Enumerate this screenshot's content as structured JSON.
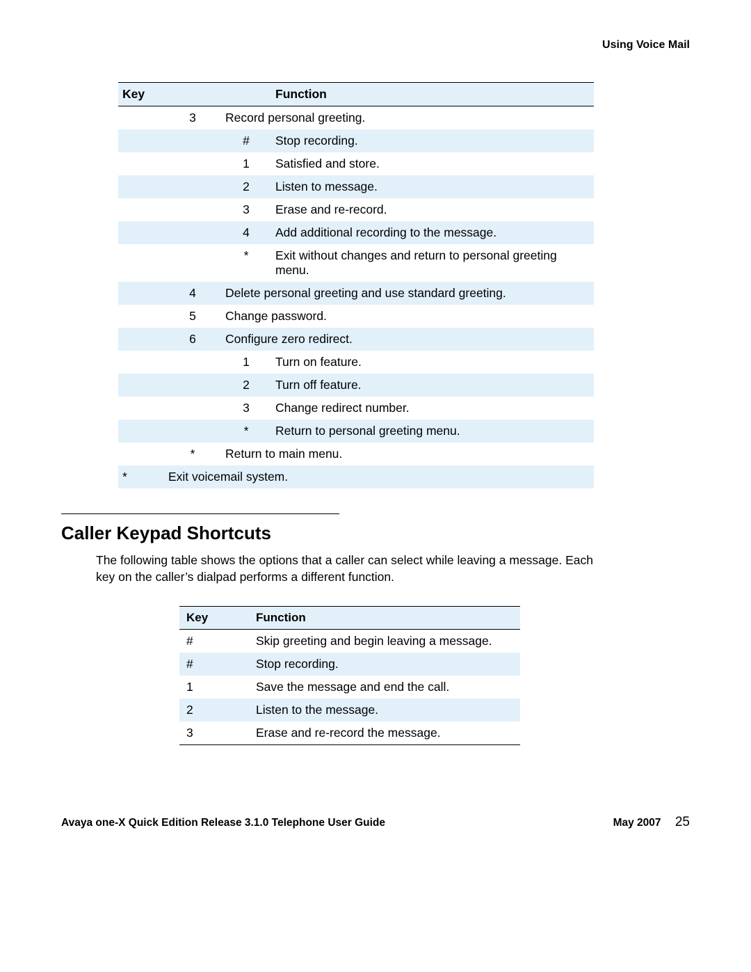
{
  "running_head": "Using Voice Mail",
  "table1": {
    "headers": {
      "key": "Key",
      "func": "Function"
    },
    "rows": [
      {
        "a": "",
        "b": "3",
        "c": "",
        "d": "Record personal greeting.",
        "shade": false
      },
      {
        "a": "",
        "b": "",
        "c": "#",
        "d": "Stop recording.",
        "shade": true
      },
      {
        "a": "",
        "b": "",
        "c": "1",
        "d": "Satisfied and store.",
        "shade": false
      },
      {
        "a": "",
        "b": "",
        "c": "2",
        "d": "Listen to message.",
        "shade": true
      },
      {
        "a": "",
        "b": "",
        "c": "3",
        "d": "Erase and re-record.",
        "shade": false
      },
      {
        "a": "",
        "b": "",
        "c": "4",
        "d": "Add additional recording to the message.",
        "shade": true
      },
      {
        "a": "",
        "b": "",
        "c": "*",
        "d": "Exit without changes and return to personal greeting menu.",
        "shade": false
      },
      {
        "a": "",
        "b": "4",
        "c": "",
        "d": "Delete personal greeting and use standard greeting.",
        "shade": true
      },
      {
        "a": "",
        "b": "5",
        "c": "",
        "d": "Change password.",
        "shade": false
      },
      {
        "a": "",
        "b": "6",
        "c": "",
        "d": "Configure zero redirect.",
        "shade": true
      },
      {
        "a": "",
        "b": "",
        "c": "1",
        "d": "Turn on feature.",
        "shade": false
      },
      {
        "a": "",
        "b": "",
        "c": "2",
        "d": "Turn off feature.",
        "shade": true
      },
      {
        "a": "",
        "b": "",
        "c": "3",
        "d": "Change redirect number.",
        "shade": false
      },
      {
        "a": "",
        "b": "",
        "c": "*",
        "d": "Return to personal greeting menu.",
        "shade": true
      },
      {
        "a": "",
        "b": "*",
        "c": "",
        "d": "Return to main menu.",
        "shade": false
      },
      {
        "a": "*",
        "b": "",
        "c": "",
        "d": "Exit voicemail system.",
        "shade": true,
        "last": true
      }
    ]
  },
  "section_title": "Caller Keypad Shortcuts",
  "intro_text": "The following table shows the options that a caller can select while leaving a message. Each key on the caller’s dialpad performs a different function.",
  "table2": {
    "headers": {
      "key": "Key",
      "func": "Function"
    },
    "rows": [
      {
        "k": "#",
        "f": "Skip greeting and begin leaving a message.",
        "shade": false
      },
      {
        "k": "#",
        "f": "Stop recording.",
        "shade": true
      },
      {
        "k": "1",
        "f": "Save the message and end the call.",
        "shade": false
      },
      {
        "k": "2",
        "f": "Listen to the message.",
        "shade": true
      },
      {
        "k": "3",
        "f": "Erase and re-record the message.",
        "shade": false,
        "last": true
      }
    ]
  },
  "footer": {
    "left": "Avaya one-X Quick Edition Release 3.1.0 Telephone User Guide",
    "date": "May 2007",
    "page": "25"
  }
}
